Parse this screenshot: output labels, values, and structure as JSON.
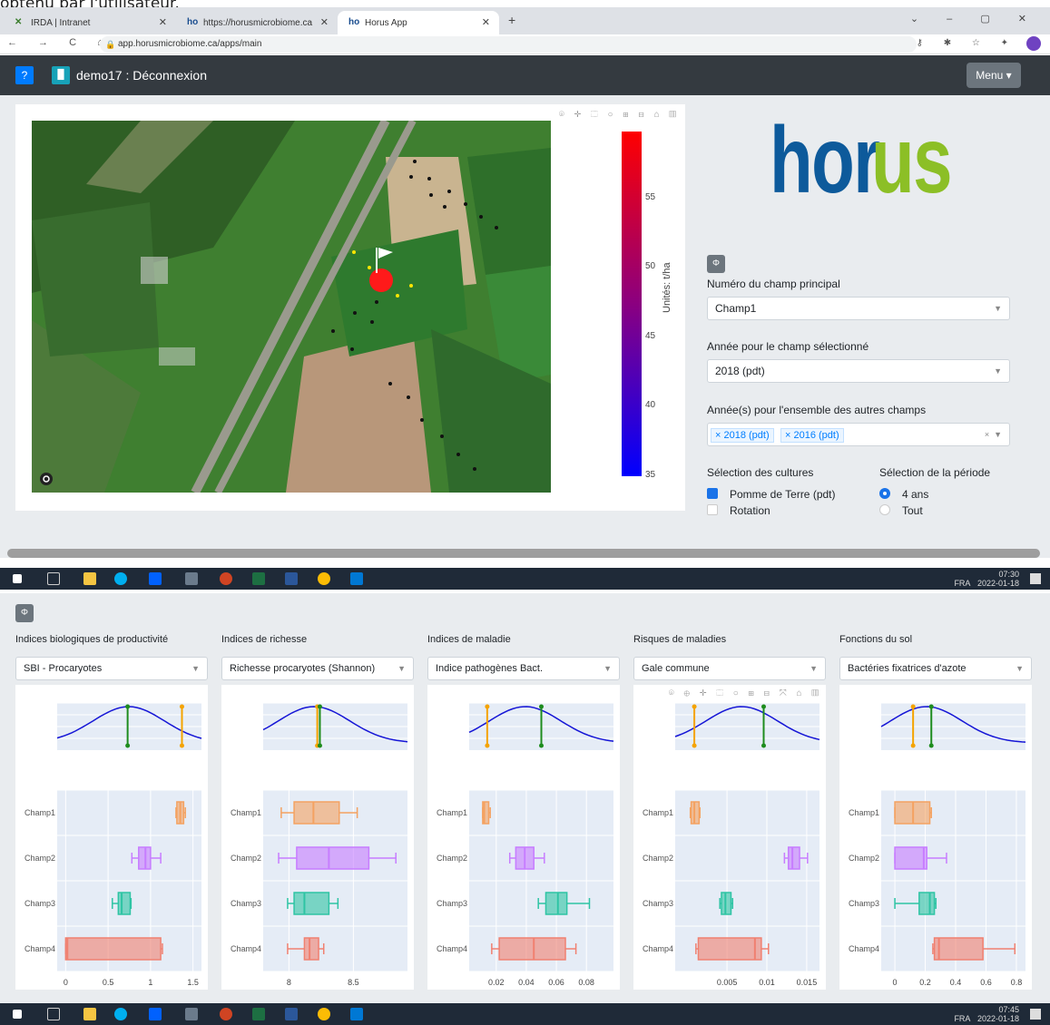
{
  "caption": "obtenu par l'utilisateur.",
  "browser": {
    "tabs": [
      {
        "label": "IRDA | Intranet"
      },
      {
        "label": "https://horusmicrobiome.ca"
      },
      {
        "label": "Horus App"
      }
    ],
    "url": "app.horusmicrobiome.ca/apps/main"
  },
  "navbar": {
    "help": "?",
    "title": "demo17 : Déconnexion",
    "menu": "Menu"
  },
  "map": {
    "colorbar_ticks": [
      "55",
      "50",
      "45",
      "40",
      "35"
    ],
    "colorbar_label": "Unités: t/ha"
  },
  "logo": {
    "left": "hor",
    "right": "us"
  },
  "controls": {
    "toggle": "Φ",
    "field_label": "Numéro du champ principal",
    "field_value": "Champ1",
    "year_label": "Année pour le champ sélectionné",
    "year_value": "2018 (pdt)",
    "years_label": "Année(s) pour l'ensemble des autres champs",
    "years_tags": [
      "2018 (pdt)",
      "2016 (pdt)"
    ],
    "cultures_label": "Sélection des cultures",
    "culture_1": "Pomme de Terre (pdt)",
    "culture_2": "Rotation",
    "period_label": "Sélection de la période",
    "period_1": "4 ans",
    "period_2": "Tout"
  },
  "taskbar": [
    {
      "time": "07:30",
      "date": "2022-01-18",
      "lang": "FRA"
    },
    {
      "time": "07:45",
      "date": "2022-01-18",
      "lang": "FRA"
    }
  ],
  "panels": [
    {
      "label": "Indices biologiques de productivité",
      "select": "SBI - Procaryotes"
    },
    {
      "label": "Indices de richesse",
      "select": "Richesse procaryotes (Shannon)"
    },
    {
      "label": "Indices de maladie",
      "select": "Indice pathogènes Bact."
    },
    {
      "label": "Risques de maladies",
      "select": "Gale commune"
    },
    {
      "label": "Fonctions du sol",
      "select": "Bactéries fixatrices d'azote"
    }
  ],
  "chart_data": [
    {
      "type": "box",
      "categories": [
        "Champ1",
        "Champ2",
        "Champ3",
        "Champ4"
      ],
      "xticks": [
        "0",
        "0.5",
        "1",
        "1.5"
      ],
      "xlim": [
        -0.1,
        1.6
      ],
      "boxes": [
        {
          "min": 1.3,
          "q1": 1.31,
          "median": 1.35,
          "q3": 1.39,
          "max": 1.41,
          "color": "#f4a261"
        },
        {
          "min": 0.78,
          "q1": 0.86,
          "median": 0.94,
          "q3": 1.0,
          "max": 1.12,
          "color": "#c77dff"
        },
        {
          "min": 0.55,
          "q1": 0.62,
          "median": 0.66,
          "q3": 0.76,
          "max": 0.77,
          "color": "#2ec4a4"
        },
        {
          "min": 0.0,
          "q1": 0.0,
          "median": 0.02,
          "q3": 1.12,
          "max": 1.14,
          "color": "#f08070"
        }
      ],
      "curve_lines": [
        {
          "x": 0.73,
          "color": "#1e8c1e"
        },
        {
          "x": 1.37,
          "color": "#f4a300"
        }
      ]
    },
    {
      "type": "box",
      "categories": [
        "Champ1",
        "Champ2",
        "Champ3",
        "Champ4"
      ],
      "xticks": [
        "8",
        "8.5"
      ],
      "xlim": [
        7.8,
        8.92
      ],
      "boxes": [
        {
          "min": 7.94,
          "q1": 8.04,
          "median": 8.19,
          "q3": 8.39,
          "max": 8.53,
          "color": "#f4a261"
        },
        {
          "min": 7.92,
          "q1": 8.06,
          "median": 8.31,
          "q3": 8.62,
          "max": 8.83,
          "color": "#c77dff"
        },
        {
          "min": 7.99,
          "q1": 8.04,
          "median": 8.12,
          "q3": 8.31,
          "max": 8.38,
          "color": "#2ec4a4"
        },
        {
          "min": 7.99,
          "q1": 8.12,
          "median": 8.16,
          "q3": 8.23,
          "max": 8.27,
          "color": "#f08070"
        }
      ],
      "curve_lines": [
        {
          "x": 8.22,
          "color": "#f4a300"
        },
        {
          "x": 8.24,
          "color": "#1e8c1e"
        }
      ]
    },
    {
      "type": "box",
      "categories": [
        "Champ1",
        "Champ2",
        "Champ3",
        "Champ4"
      ],
      "xticks": [
        "0.02",
        "0.04",
        "0.06",
        "0.08"
      ],
      "xlim": [
        0.002,
        0.098
      ],
      "boxes": [
        {
          "min": 0.011,
          "q1": 0.011,
          "median": 0.012,
          "q3": 0.015,
          "max": 0.016,
          "color": "#f4a261"
        },
        {
          "min": 0.029,
          "q1": 0.033,
          "median": 0.039,
          "q3": 0.045,
          "max": 0.052,
          "color": "#c77dff"
        },
        {
          "min": 0.048,
          "q1": 0.053,
          "median": 0.061,
          "q3": 0.067,
          "max": 0.082,
          "color": "#2ec4a4"
        },
        {
          "min": 0.017,
          "q1": 0.022,
          "median": 0.045,
          "q3": 0.066,
          "max": 0.073,
          "color": "#f08070"
        }
      ],
      "curve_lines": [
        {
          "x": 0.014,
          "color": "#f4a300"
        },
        {
          "x": 0.05,
          "color": "#1e8c1e"
        }
      ]
    },
    {
      "type": "box",
      "categories": [
        "Champ1",
        "Champ2",
        "Champ3",
        "Champ4"
      ],
      "xticks": [
        "0.005",
        "0.01",
        "0.015"
      ],
      "xlim": [
        -0.0015,
        0.0166
      ],
      "boxes": [
        {
          "min": 0.0004,
          "q1": 0.0005,
          "median": 0.0009,
          "q3": 0.0015,
          "max": 0.0016,
          "color": "#f4a261"
        },
        {
          "min": 0.0122,
          "q1": 0.0127,
          "median": 0.0132,
          "q3": 0.0141,
          "max": 0.0151,
          "color": "#c77dff"
        },
        {
          "min": 0.0041,
          "q1": 0.0043,
          "median": 0.0048,
          "q3": 0.0055,
          "max": 0.0057,
          "color": "#2ec4a4"
        },
        {
          "min": 0.0011,
          "q1": 0.0014,
          "median": 0.0085,
          "q3": 0.0093,
          "max": 0.0102,
          "color": "#f08070"
        }
      ],
      "curve_lines": [
        {
          "x": 0.0009,
          "color": "#f4a300"
        },
        {
          "x": 0.0096,
          "color": "#1e8c1e"
        }
      ]
    },
    {
      "type": "box",
      "categories": [
        "Champ1",
        "Champ2",
        "Champ3",
        "Champ4"
      ],
      "xticks": [
        "0",
        "0.2",
        "0.4",
        "0.6",
        "0.8"
      ],
      "xlim": [
        -0.09,
        0.86
      ],
      "boxes": [
        {
          "min": 0.0,
          "q1": 0.0,
          "median": 0.12,
          "q3": 0.23,
          "max": 0.24,
          "color": "#f4a261"
        },
        {
          "min": 0.0,
          "q1": 0.0,
          "median": 0.19,
          "q3": 0.21,
          "max": 0.34,
          "color": "#c77dff"
        },
        {
          "min": 0.0,
          "q1": 0.16,
          "median": 0.23,
          "q3": 0.26,
          "max": 0.27,
          "color": "#2ec4a4"
        },
        {
          "min": 0.25,
          "q1": 0.26,
          "median": 0.29,
          "q3": 0.58,
          "max": 0.79,
          "color": "#f08070"
        }
      ],
      "curve_lines": [
        {
          "x": 0.12,
          "color": "#f4a300"
        },
        {
          "x": 0.24,
          "color": "#1e8c1e"
        }
      ]
    }
  ]
}
